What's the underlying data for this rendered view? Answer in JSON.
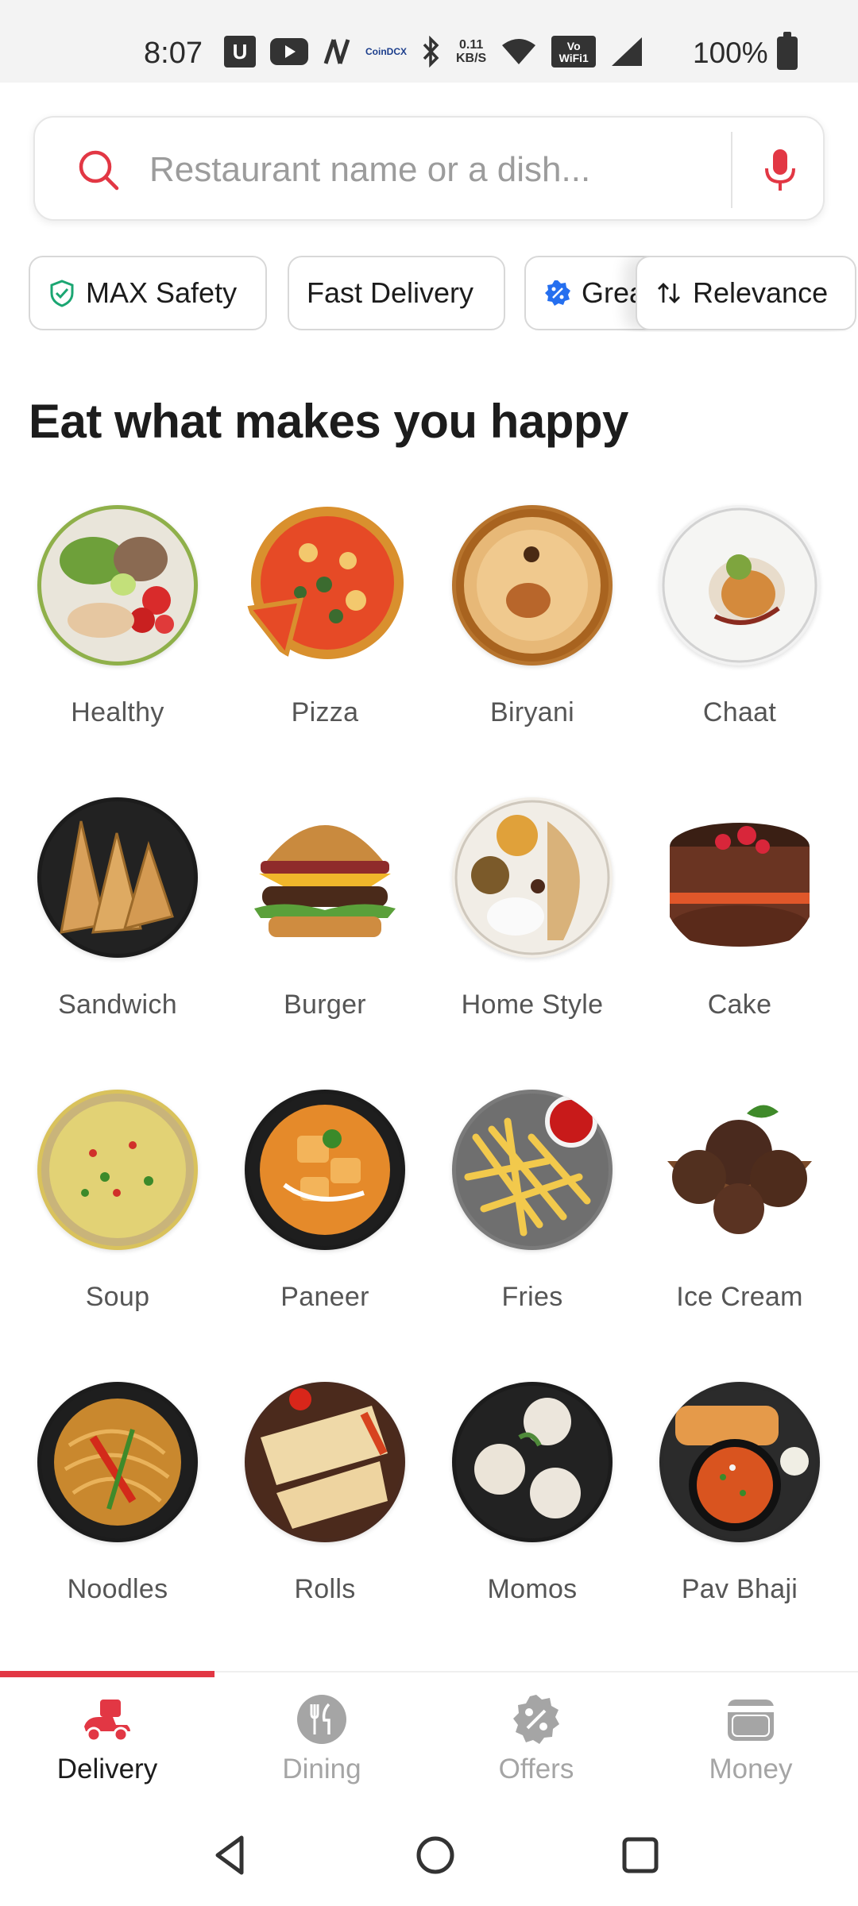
{
  "status_bar": {
    "time": "8:07",
    "network_speed_value": "0.11",
    "network_speed_unit": "KB/S",
    "battery": "100%",
    "notif_u": "U",
    "app_coindcx": "CoinDCX",
    "vowifi_line1": "Vo",
    "vowifi_line2": "WiFi1",
    "icons": [
      "u-icon",
      "youtube-icon",
      "n-icon",
      "coindcx-icon",
      "bluetooth-icon",
      "wifi-icon",
      "vowifi-icon",
      "signal-icon",
      "battery-icon"
    ]
  },
  "search": {
    "placeholder": "Restaurant name or a dish...",
    "value": ""
  },
  "filters": [
    {
      "label": "MAX Safety",
      "icon": "shield-check-icon"
    },
    {
      "label": "Fast Delivery"
    },
    {
      "label": "Great Offers",
      "icon": "discount-badge-icon"
    },
    {
      "label": "Relevance",
      "icon": "sort-arrows-icon"
    }
  ],
  "section_title": "Eat what makes you happy",
  "categories": [
    {
      "label": "Healthy"
    },
    {
      "label": "Pizza"
    },
    {
      "label": "Biryani"
    },
    {
      "label": "Chaat"
    },
    {
      "label": "Sandwich"
    },
    {
      "label": "Burger"
    },
    {
      "label": "Home Style"
    },
    {
      "label": "Cake"
    },
    {
      "label": "Soup"
    },
    {
      "label": "Paneer"
    },
    {
      "label": "Fries"
    },
    {
      "label": "Ice Cream"
    },
    {
      "label": "Noodles"
    },
    {
      "label": "Rolls"
    },
    {
      "label": "Momos"
    },
    {
      "label": "Pav Bhaji"
    }
  ],
  "bottom_nav": [
    {
      "label": "Delivery",
      "icon": "delivery-scooter-icon",
      "active": true
    },
    {
      "label": "Dining",
      "icon": "dining-cutlery-icon"
    },
    {
      "label": "Offers",
      "icon": "offers-percent-icon"
    },
    {
      "label": "Money",
      "icon": "wallet-icon"
    }
  ],
  "colors": {
    "brand": "#e23744",
    "inactive": "#a5a5a5",
    "text": "#1c1c1c"
  }
}
